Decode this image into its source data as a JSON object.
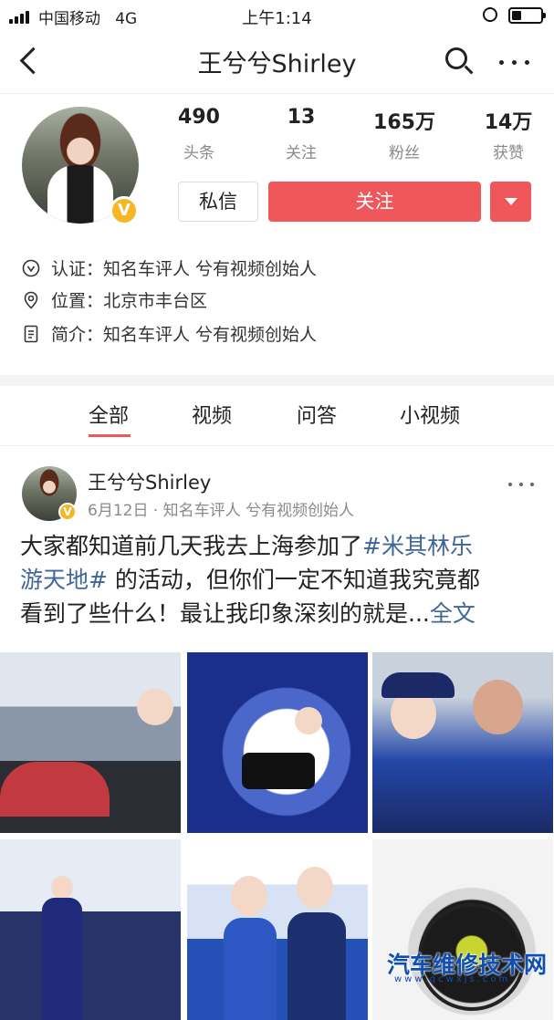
{
  "status_bar": {
    "carrier": "中国移动",
    "network": "4G",
    "time": "上午1:14"
  },
  "nav": {
    "title": "王兮兮Shirley"
  },
  "profile": {
    "stats": [
      {
        "value": "490",
        "label": "头条"
      },
      {
        "value": "13",
        "label": "关注"
      },
      {
        "value": "165万",
        "label": "粉丝"
      },
      {
        "value": "14万",
        "label": "获赞"
      }
    ],
    "message_button": "私信",
    "follow_button": "关注",
    "info": [
      {
        "icon": "verified-icon",
        "text": "认证：知名车评人 兮有视频创始人"
      },
      {
        "icon": "location-icon",
        "text": "位置：北京市丰台区"
      },
      {
        "icon": "document-icon",
        "text": "简介：知名车评人  兮有视频创始人"
      }
    ]
  },
  "tabs": [
    "全部",
    "视频",
    "问答",
    "小视频"
  ],
  "post": {
    "author": "王兮兮Shirley",
    "meta": "6月12日 · 知名车评人 兮有视频创始人",
    "text_line1_prefix": "大家都知道前几天我去上海参加了",
    "hashtag_part1": "#米其林乐",
    "hashtag_part2": "游天地#",
    "text_line2_suffix": " 的活动，但你们一定不知道我究竟都",
    "text_line3": "看到了些什么！最让我印象深刻的就是...",
    "full_text_link": "全文"
  },
  "watermark": {
    "title": "汽车维修技术网",
    "url": "www.qcwxjs.com"
  }
}
